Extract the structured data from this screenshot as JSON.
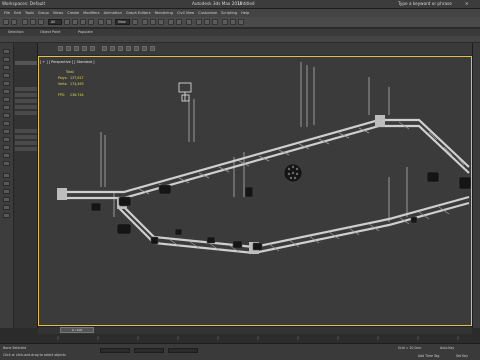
{
  "titlebar": {
    "workspace_label": "Workspaces: Default",
    "app_title": "Autodesk 3ds Max 2018",
    "file_name": "Untitled",
    "search_placeholder": "Type a keyword or phrase"
  },
  "menubar": {
    "items": [
      "File",
      "Edit",
      "Tools",
      "Group",
      "Views",
      "Create",
      "Modifiers",
      "Animation",
      "Graph Editors",
      "Rendering",
      "Civil View",
      "Customize",
      "Scripting",
      "Help"
    ]
  },
  "toolbar": {
    "selection_filter": "All",
    "coordinate_system": "View"
  },
  "ribbon": {
    "tabs": [
      "Selection",
      "Object Paint",
      "Populate"
    ]
  },
  "viewport": {
    "label": "[ + ] [ Perspective ] [ Standard ]",
    "stats": {
      "total_label": "Total",
      "polys_label": "Polys:",
      "polys_value": "137,817",
      "verts_label": "Verts:",
      "verts_value": "174,493",
      "fps_label": "FPS:",
      "fps_value": "236.744"
    }
  },
  "timeline": {
    "slider_label": "0 / 100"
  },
  "statusbar": {
    "line1": "None Selected",
    "line2": "Click or click-and-drag to select objects",
    "grid_label": "Grid = 10.0cm",
    "add_time_tag": "Add Time Tag",
    "auto_key": "Auto Key",
    "set_key": "Set Key"
  },
  "colors": {
    "accent": "#e4c04a",
    "viewport_bg": "#3b3b3b",
    "truss": "#c9c9c9"
  }
}
